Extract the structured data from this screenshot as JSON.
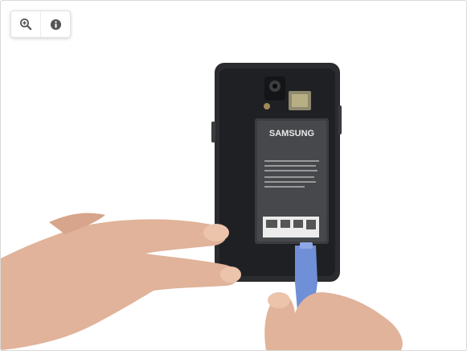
{
  "toolbar": {
    "zoom_icon": "zoom-in-icon",
    "info_icon": "info-icon"
  },
  "photo": {
    "battery_brand": "SAMSUNG",
    "colors": {
      "phone_body": "#2b2c2f",
      "battery": "#3a3c40",
      "pry_tool": "#6f8fd6",
      "skin": "#e0b39a"
    }
  }
}
